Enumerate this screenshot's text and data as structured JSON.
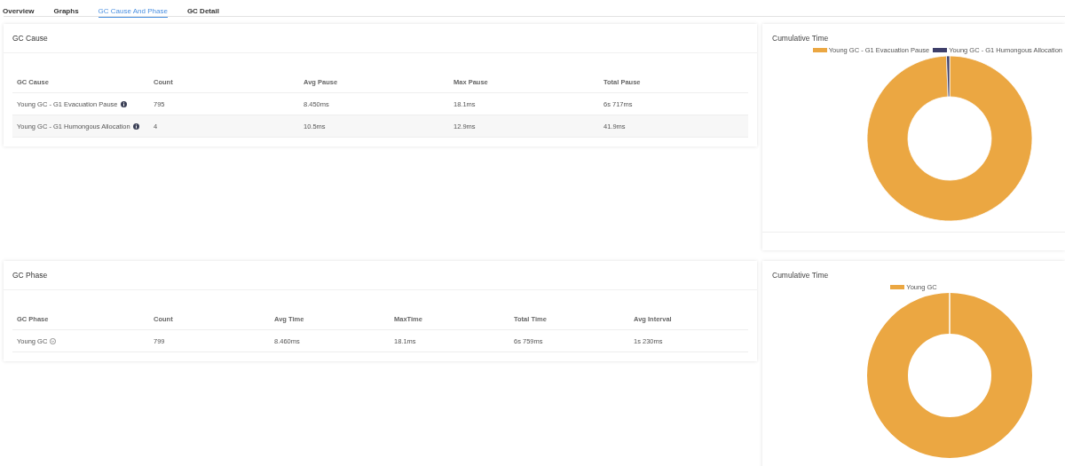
{
  "tabs": [
    {
      "label": "Overview",
      "selected": false
    },
    {
      "label": "Graphs",
      "selected": false
    },
    {
      "label": "GC Cause And Phase",
      "selected": true
    },
    {
      "label": "GC Detail",
      "selected": false
    }
  ],
  "sections": [
    {
      "table": {
        "title": "GC Cause",
        "columns": [
          "GC Cause",
          "Count",
          "Avg Pause",
          "Max Pause",
          "Total Pause"
        ],
        "rows": [
          {
            "kind": "info",
            "cells": [
              "Young GC - G1 Evacuation Pause",
              "795",
              "8.450ms",
              "18.1ms",
              "6s 717ms"
            ]
          },
          {
            "kind": "info",
            "cells": [
              "Young GC - G1 Humongous Allocation",
              "4",
              "10.5ms",
              "12.9ms",
              "41.9ms"
            ]
          }
        ]
      },
      "chart": {
        "title": "Cumulative Time",
        "legend": [
          {
            "label": "Young GC - G1 Evacuation Pause",
            "color": "#eba742"
          },
          {
            "label": "Young GC - G1 Humongous Allocation",
            "color": "#3e3f6a"
          }
        ]
      }
    },
    {
      "table": {
        "title": "GC Phase",
        "columns": [
          "GC Phase",
          "Count",
          "Avg Time",
          "MaxTime",
          "Total Time",
          "Avg Interval"
        ],
        "rows": [
          {
            "kind": "expand",
            "cells": [
              "Young GC",
              "799",
              "8.460ms",
              "18.1ms",
              "6s 759ms",
              "1s 230ms"
            ]
          }
        ]
      },
      "chart": {
        "title": "Cumulative Time",
        "legend": [
          {
            "label": "Young GC",
            "color": "#eba742"
          }
        ]
      }
    }
  ]
}
